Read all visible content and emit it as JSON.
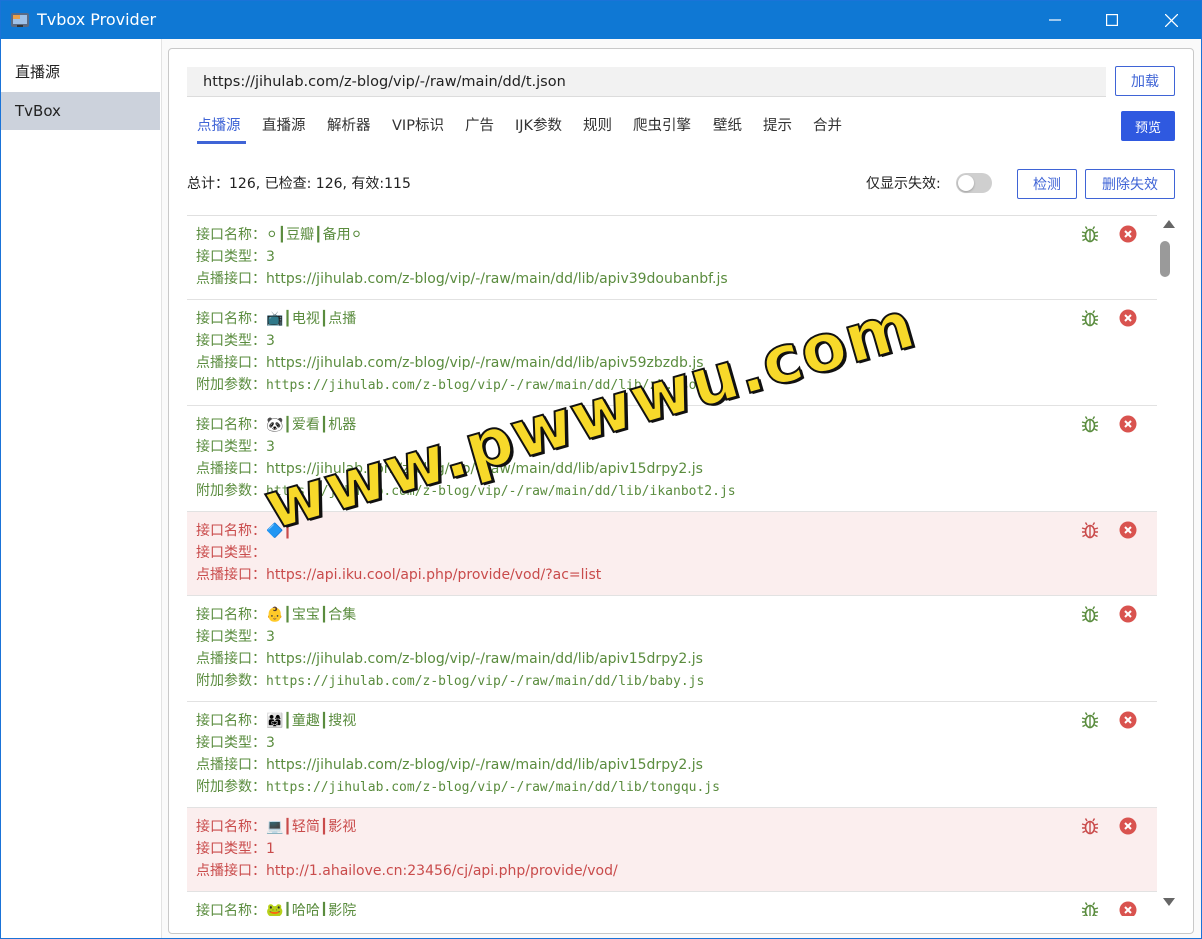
{
  "window": {
    "title": "Tvbox Provider"
  },
  "sidebar": {
    "items": [
      {
        "label": "直播源"
      },
      {
        "label": "TvBox"
      }
    ]
  },
  "toolbar": {
    "url_value": "https://jihulab.com/z-blog/vip/-/raw/main/dd/t.json",
    "load_label": "加载",
    "preview_label": "预览"
  },
  "tabs": [
    {
      "label": "点播源"
    },
    {
      "label": "直播源"
    },
    {
      "label": "解析器"
    },
    {
      "label": "VIP标识"
    },
    {
      "label": "广告"
    },
    {
      "label": "IJK参数"
    },
    {
      "label": "规则"
    },
    {
      "label": "爬虫引擎"
    },
    {
      "label": "壁纸"
    },
    {
      "label": "提示"
    },
    {
      "label": "合并"
    }
  ],
  "stats": {
    "text": "总计：126, 已检查: 126, 有效:115",
    "toggle_label": "仅显示失效:",
    "toggle_on": false,
    "check_label": "检测",
    "delete_invalid_label": "删除失效"
  },
  "fields": {
    "name": "接口名称：",
    "type": "接口类型：",
    "api": "点播接口：",
    "ext": "附加参数："
  },
  "items": [
    {
      "name": "⚪┃豆瓣┃备用⚪",
      "type": "3",
      "api": "https://jihulab.com/z-blog/vip/-/raw/main/dd/lib/apiv39doubanbf.js",
      "failed": false
    },
    {
      "name": "📺┃电视┃点播",
      "type": "3",
      "api": "https://jihulab.com/z-blog/vip/-/raw/main/dd/lib/apiv59zbzdb.js",
      "ext": "https://jihulab.com/z-blog/vip/-/raw/main/dd/lib/zb.json",
      "failed": false
    },
    {
      "name": "🐼┃爱看┃机器",
      "type": "3",
      "api": "https://jihulab.com/z-blog/vip/-/raw/main/dd/lib/apiv15drpy2.js",
      "ext": "https://jihulab.com/z-blog/vip/-/raw/main/dd/lib/ikanbot2.js",
      "failed": false
    },
    {
      "name": "🔷┃",
      "type": "",
      "api": "https://api.iku.cool/api.php/provide/vod/?ac=list",
      "failed": true
    },
    {
      "name": "👶┃宝宝┃合集",
      "type": "3",
      "api": "https://jihulab.com/z-blog/vip/-/raw/main/dd/lib/apiv15drpy2.js",
      "ext": "https://jihulab.com/z-blog/vip/-/raw/main/dd/lib/baby.js",
      "failed": false
    },
    {
      "name": "👨‍👩‍👧┃童趣┃搜视",
      "type": "3",
      "api": "https://jihulab.com/z-blog/vip/-/raw/main/dd/lib/apiv15drpy2.js",
      "ext": "https://jihulab.com/z-blog/vip/-/raw/main/dd/lib/tongqu.js",
      "failed": false
    },
    {
      "name": "💻┃轻简┃影视",
      "type": "1",
      "api": "http://1.ahailove.cn:23456/cj/api.php/provide/vod/",
      "failed": true
    },
    {
      "name": "🐸┃哈哈┃影院",
      "failed": false
    }
  ],
  "colors": {
    "accent": "#3f64d6",
    "titlebar": "#0f78d4",
    "valid_text": "#5a8c3e",
    "failed_text": "#c94b4b",
    "failed_bg": "#fbeeee",
    "delete_icon": "#d9534f"
  },
  "icons": {
    "app": "app-icon",
    "bug": "bug-icon",
    "delete": "close-circle-icon"
  },
  "watermark": "www.pwwwu.com"
}
